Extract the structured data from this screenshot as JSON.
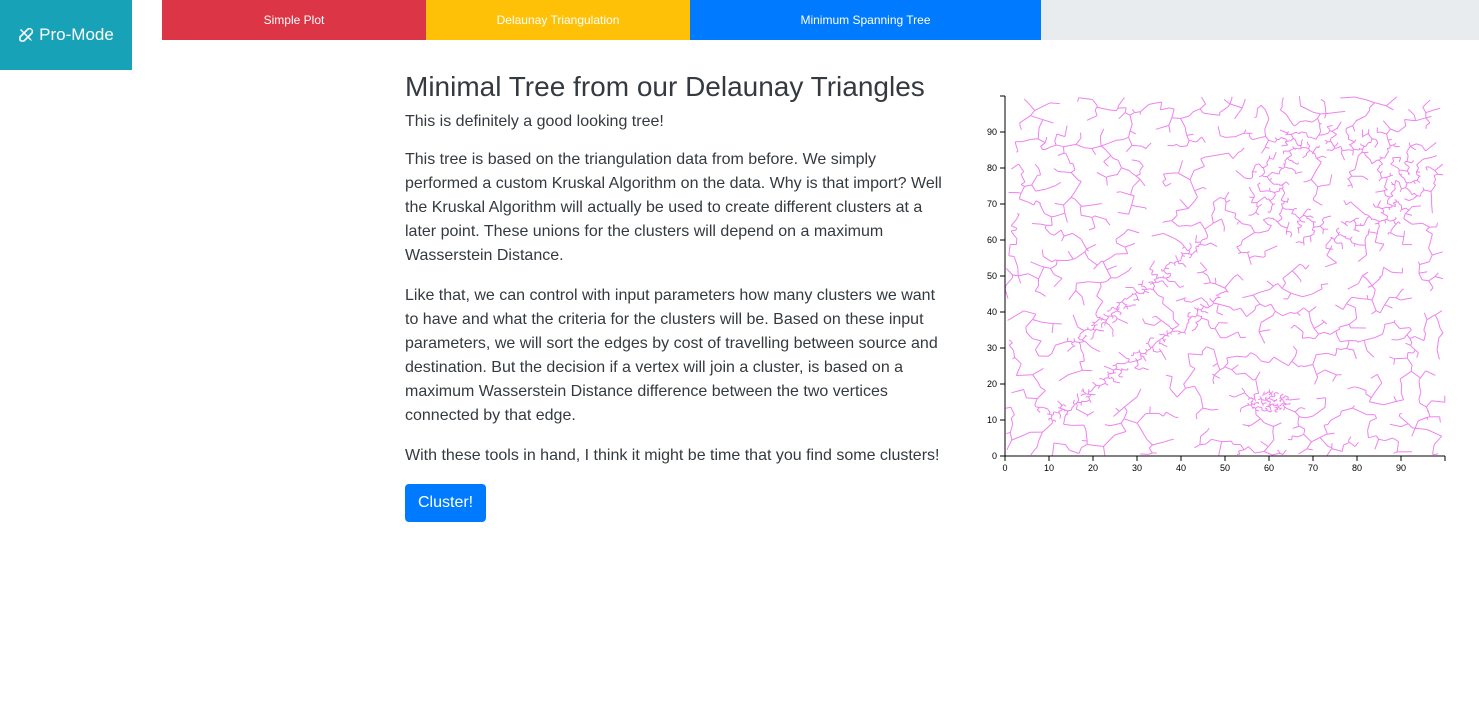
{
  "sidebar": {
    "pro_mode_label": "Pro-Mode",
    "icon": "tools-icon"
  },
  "tabs": [
    {
      "label": "Simple Plot",
      "color": "#dc3545"
    },
    {
      "label": "Delaunay Triangulation",
      "color": "#ffc107"
    },
    {
      "label": "Minimum Spanning Tree",
      "color": "#007bff"
    }
  ],
  "main": {
    "title": "Minimal Tree from our Delaunay Triangles",
    "paragraphs": [
      "This is definitely a good looking tree!",
      "This tree is based on the triangulation data from before. We simply performed a custom Kruskal Algorithm on the data. Why is that import? Well the Kruskal Algorithm will actually be used to create different clusters at a later point. These unions for the clusters will depend on a maximum Wasserstein Distance.",
      "Like that, we can control with input parameters how many clusters we want to have and what the criteria for the clusters will be. Based on these input parameters, we will sort the edges by cost of travelling between source and destination. But the decision if a vertex will join a cluster, is based on a maximum Wasserstein Distance difference between the two vertices connected by that edge.",
      "With these tools in hand, I think it might be time that you find some clusters!"
    ],
    "cluster_button": "Cluster!"
  },
  "chart_data": {
    "type": "scatter",
    "description_series": "minimum spanning tree edges",
    "xlim": [
      0,
      100
    ],
    "ylim": [
      0,
      100
    ],
    "x_ticks": [
      0,
      10,
      20,
      30,
      40,
      50,
      60,
      70,
      80,
      90
    ],
    "y_ticks": [
      0,
      10,
      20,
      30,
      40,
      50,
      60,
      70,
      80,
      90
    ],
    "edge_color": "#ee82ee",
    "grid": false,
    "dense_regions": [
      {
        "shape": "line",
        "from": [
          15,
          30
        ],
        "to": [
          45,
          60
        ],
        "note": "upper diagonal band"
      },
      {
        "shape": "line",
        "from": [
          10,
          10
        ],
        "to": [
          50,
          45
        ],
        "note": "lower diagonal band"
      },
      {
        "shape": "blob",
        "center": [
          60,
          15
        ],
        "radius": 5
      },
      {
        "shape": "ring",
        "center": [
          75,
          75
        ],
        "radius": 18
      }
    ]
  }
}
